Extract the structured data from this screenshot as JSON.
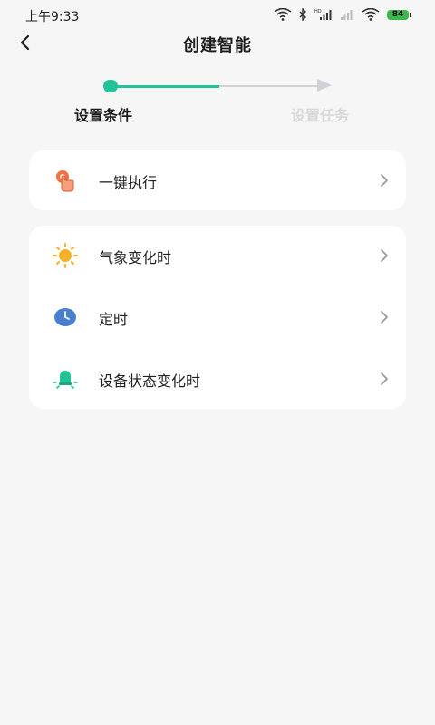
{
  "status_bar": {
    "time": "上午9:33",
    "battery_level": "84",
    "icons": [
      "wifi-icon",
      "bluetooth-icon",
      "signal-hd-icon",
      "signal-icon",
      "wifi-icon",
      "battery-icon"
    ],
    "battery_color": "#3cb54a"
  },
  "header": {
    "title": "创建智能",
    "back_icon": "chevron-left-icon"
  },
  "stepper": {
    "steps": [
      {
        "label": "设置条件",
        "active": true
      },
      {
        "label": "设置任务",
        "active": false
      }
    ],
    "accent_color": "#23c39a",
    "inactive_color": "#d2d2d6"
  },
  "conditions": {
    "group1": [
      {
        "label": "一键执行",
        "icon": "tap-hand-icon",
        "icon_color": "#f07040"
      }
    ],
    "group2": [
      {
        "label": "气象变化时",
        "icon": "sun-icon",
        "icon_color": "#f5b12a"
      },
      {
        "label": "定时",
        "icon": "clock-icon",
        "icon_color": "#4a7fd0"
      },
      {
        "label": "设备状态变化时",
        "icon": "lightbulb-icon",
        "icon_color": "#23c39a"
      }
    ]
  }
}
